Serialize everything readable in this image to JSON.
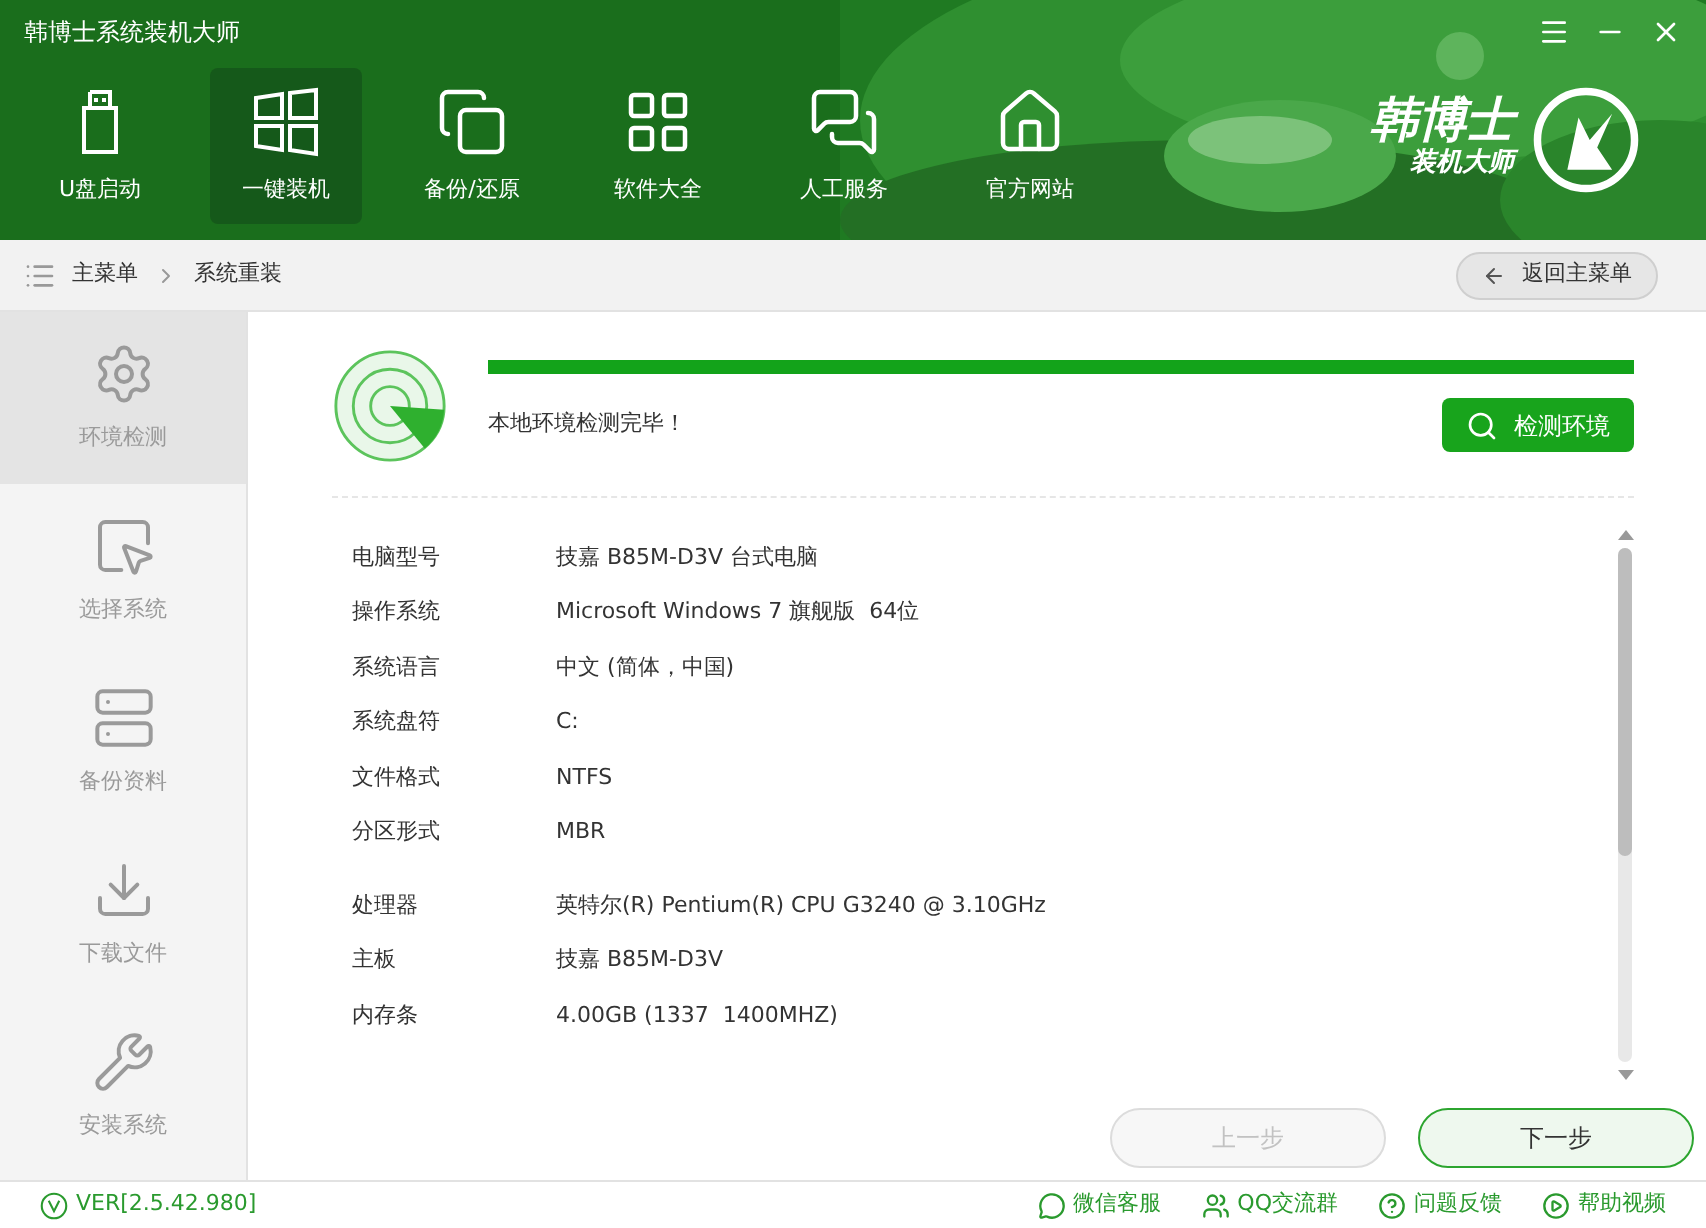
{
  "window": {
    "title": "韩博士系统装机大师"
  },
  "nav": [
    {
      "label": "U盘启动",
      "selected": false
    },
    {
      "label": "一键装机",
      "selected": true
    },
    {
      "label": "备份/还原",
      "selected": false
    },
    {
      "label": "软件大全",
      "selected": false
    },
    {
      "label": "人工服务",
      "selected": false
    },
    {
      "label": "官方网站",
      "selected": false
    }
  ],
  "logo": {
    "name": "韩博士",
    "tagline": "装机大师"
  },
  "breadcrumb": {
    "items": [
      "主菜单",
      "系统重装"
    ],
    "back_button": "返回主菜单"
  },
  "sidebar": {
    "items": [
      {
        "label": "环境检测",
        "selected": true
      },
      {
        "label": "选择系统",
        "selected": false
      },
      {
        "label": "备份资料",
        "selected": false
      },
      {
        "label": "下载文件",
        "selected": false
      },
      {
        "label": "安装系统",
        "selected": false
      }
    ]
  },
  "detection": {
    "level": 1,
    "message": "本地环境检测完毕！",
    "button": "检测环境"
  },
  "info_groups": [
    [
      {
        "label": "电脑型号",
        "value": "技嘉 B85M-D3V 台式电脑"
      },
      {
        "label": "操作系统",
        "value": "Microsoft Windows 7 旗舰版  64位"
      },
      {
        "label": "系统语言",
        "value": "中文 (简体，中国)"
      },
      {
        "label": "系统盘符",
        "value": "C:"
      },
      {
        "label": "文件格式",
        "value": "NTFS"
      },
      {
        "label": "分区形式",
        "value": "MBR"
      }
    ],
    [
      {
        "label": "处理器",
        "value": "英特尔(R) Pentium(R) CPU G3240 @ 3.10GHz"
      },
      {
        "label": "主板",
        "value": "技嘉 B85M-D3V"
      },
      {
        "label": "内存条",
        "value": "4.00GB (1337  1400MHZ)"
      }
    ]
  ],
  "buttons": [
    {
      "label": "上一步",
      "disabled": true
    },
    {
      "label": "下一步",
      "disabled": false
    }
  ],
  "status_bar": {
    "version": "VER[2.5.42.980]",
    "links": [
      "微信客服",
      "QQ交流群",
      "问题反馈",
      "帮助视频"
    ]
  }
}
